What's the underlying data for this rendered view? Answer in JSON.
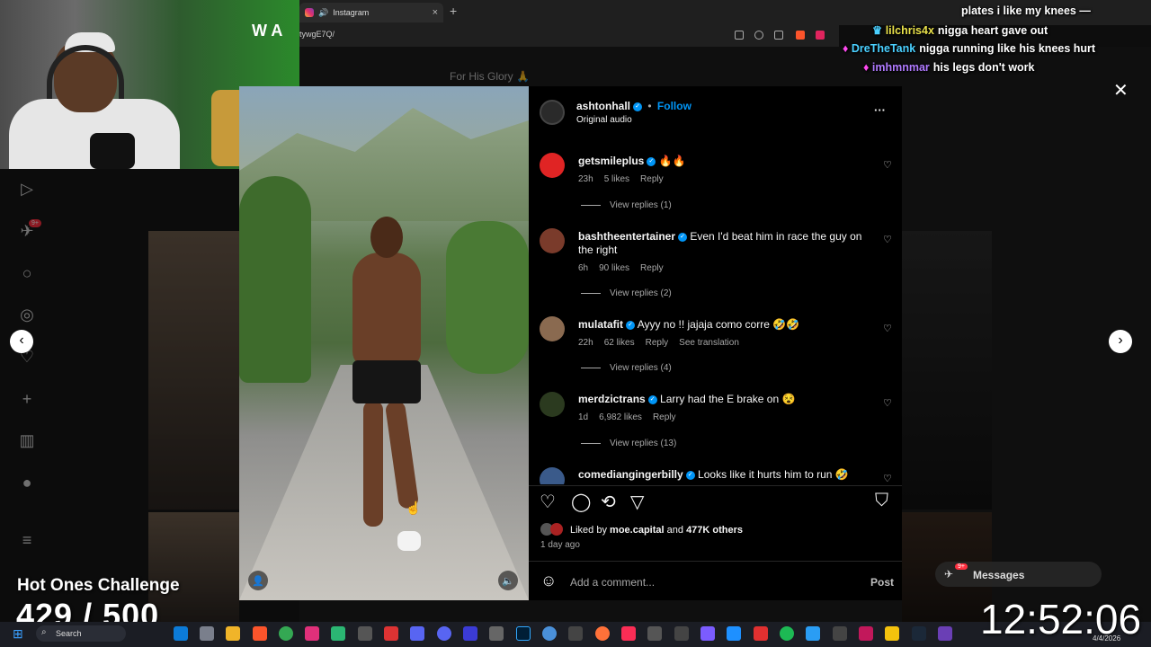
{
  "browser": {
    "tab_title": "Instagram",
    "tab_close": "×",
    "new_tab": "+",
    "url": "tywgE7Q/"
  },
  "background": {
    "for_his_glory": "For His Glory 🙏",
    "sidebar_badge": "9+",
    "messages_label": "Messages",
    "messages_badge": "9+"
  },
  "webcam": {
    "overlay_text": "W A"
  },
  "post": {
    "author": "ashtonhall",
    "follow_label": "Follow",
    "audio": "Original audio",
    "more": "···",
    "close": "✕",
    "comments": [
      {
        "user": "getsmileplus",
        "text": "🔥🔥",
        "time": "23h",
        "likes": "5 likes",
        "reply": "Reply",
        "translate": "",
        "view_replies": "View replies (1)",
        "avatar_color": "#e02424"
      },
      {
        "user": "bashtheentertainer",
        "text": "Even I'd beat him in race the guy on the right",
        "time": "6h",
        "likes": "90 likes",
        "reply": "Reply",
        "translate": "",
        "view_replies": "View replies (2)",
        "avatar_color": "#7a3b2b"
      },
      {
        "user": "mulatafit",
        "text": "Ayyy no !! jajaja como corre 🤣🤣",
        "time": "22h",
        "likes": "62 likes",
        "reply": "Reply",
        "translate": "See translation",
        "view_replies": "View replies (4)",
        "avatar_color": "#8a6a50"
      },
      {
        "user": "merdzictrans",
        "text": "Larry had the E brake on 😵",
        "time": "1d",
        "likes": "6,982 likes",
        "reply": "Reply",
        "translate": "",
        "view_replies": "View replies (13)",
        "avatar_color": "#2b3a1f"
      },
      {
        "user": "comediangingerbilly",
        "text": "Looks like it hurts him to run 🤣",
        "time": "",
        "likes": "",
        "reply": "",
        "translate": "",
        "view_replies": "",
        "avatar_color": "#3a5a8a"
      }
    ],
    "liked_by_prefix": "Liked by",
    "liked_by_user": "moe.capital",
    "liked_by_and": "and",
    "liked_by_others": "477K others",
    "posted": "1 day ago",
    "comment_placeholder": "Add a comment...",
    "post_button": "Post"
  },
  "chat": [
    {
      "name": "",
      "text": "plates i like my knees",
      "color": "#ffffff"
    },
    {
      "name": "lilchris4x",
      "text": "nigga heart gave out",
      "color": "#e8e04a"
    },
    {
      "name": "DreTheTank",
      "text": "nigga running like his knees hurt",
      "color": "#4ad0ff"
    },
    {
      "name": "imhmnmar",
      "text": "his legs don't work",
      "color": "#b07aff"
    }
  ],
  "stream": {
    "challenge_title": "Hot Ones Challenge",
    "challenge_count": "429 / 500",
    "clock": "12:52:06"
  },
  "taskbar": {
    "search_label": "Search",
    "date": "4/4/2026"
  }
}
